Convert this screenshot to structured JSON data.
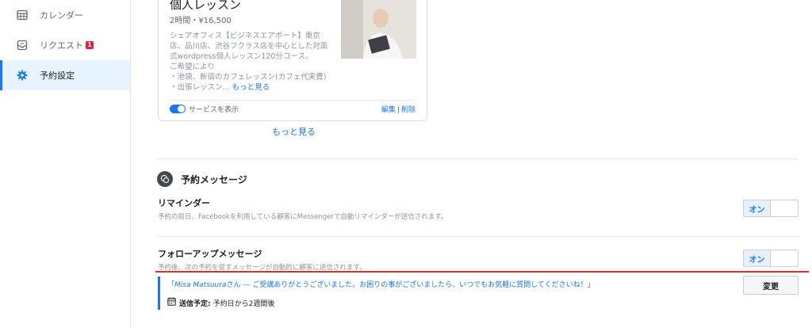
{
  "sidebar": {
    "items": [
      {
        "label": "カレンダー",
        "icon": "calendar-icon"
      },
      {
        "label": "リクエスト",
        "icon": "inbox-icon",
        "badge": "1"
      },
      {
        "label": "予約設定",
        "icon": "gear-icon",
        "active": true
      }
    ]
  },
  "service_card": {
    "title": "個人レッスン",
    "meta": "2時間・¥16,500",
    "description_lines": [
      "シェアオフィス【ビジネスエアポート】東京",
      "店、品川店、渋谷フクラス店を中心とした対面",
      "式wordpress個人レッスン120分コース。",
      "ご希望により",
      "・池袋、新宿のカフェレッスン(カフェ代実費)",
      "・出張レッスン..."
    ],
    "read_more": "もっと見る",
    "show_service_label": "サービスを表示",
    "edit_label": "編集",
    "separator": "|",
    "delete_label": "削除"
  },
  "more_link": "もっと見る",
  "booking_messages": {
    "title": "予約メッセージ",
    "reminder": {
      "title": "リマインダー",
      "description": "予約の前日、Facebookを利用している顧客にMessengerで自動リマインダーが送信されます。",
      "on_label": "オン"
    },
    "followup": {
      "title": "フォローアップメッセージ",
      "description": "予約後、次の予約を促すメッセージが自動的に顧客に送信されます。",
      "on_label": "オン",
      "quote_open": "「",
      "quote_name": "Misa Matsuura",
      "quote_body": "さん ― ご受講ありがとうございました。お困りの事がございましたら、いつでもお気軽に質問してくださいね！」",
      "schedule_label": "送信予定:",
      "schedule_value": "予約日から2週間後",
      "change_label": "変更"
    }
  },
  "colors": {
    "accent": "#1877f2",
    "annotation_line": "#d93025",
    "badge": "#e41e3f"
  }
}
